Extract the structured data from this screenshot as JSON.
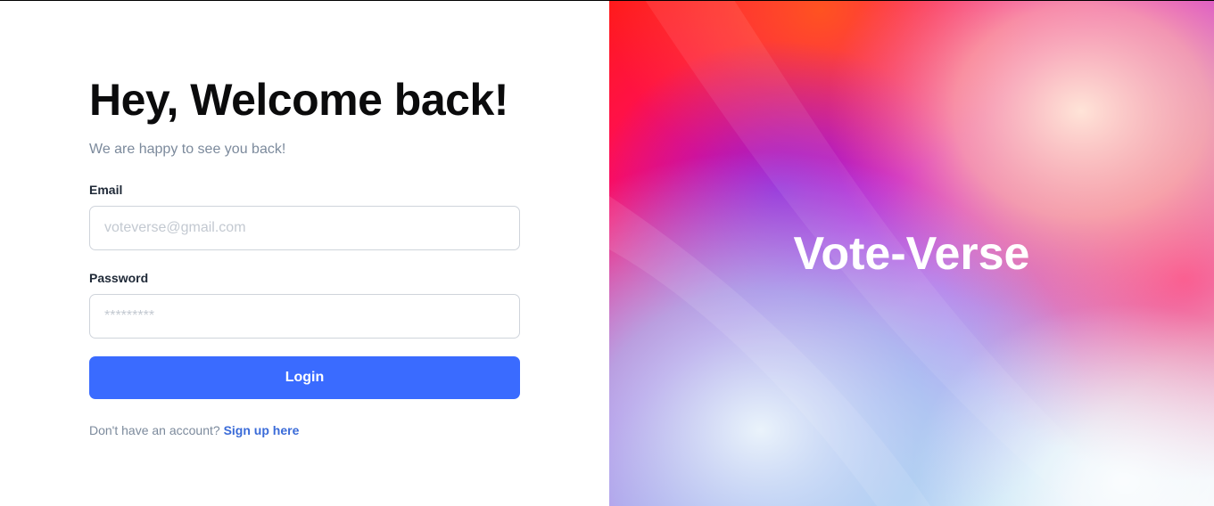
{
  "login": {
    "heading": "Hey, Welcome back!",
    "subheading": "We are happy to see you back!",
    "email_label": "Email",
    "email_placeholder": "voteverse@gmail.com",
    "email_value": "",
    "password_label": "Password",
    "password_placeholder": "*********",
    "password_value": "",
    "login_button_label": "Login",
    "signup_prompt": "Don't have an account?",
    "signup_link_label": "Sign up here"
  },
  "brand": {
    "title": "Vote-Verse"
  },
  "colors": {
    "primary": "#3a6bff",
    "link": "#3a6bd8",
    "heading": "#0b0b0c",
    "muted_text": "#7c8a9c",
    "input_border": "#cfd4db",
    "gradient_red": "#ff1a1a",
    "gradient_magenta": "#d61ad6",
    "gradient_purple": "#9b2cf0",
    "gradient_light_blue": "#bfe6f5",
    "gradient_peach": "#ffd9c9"
  }
}
